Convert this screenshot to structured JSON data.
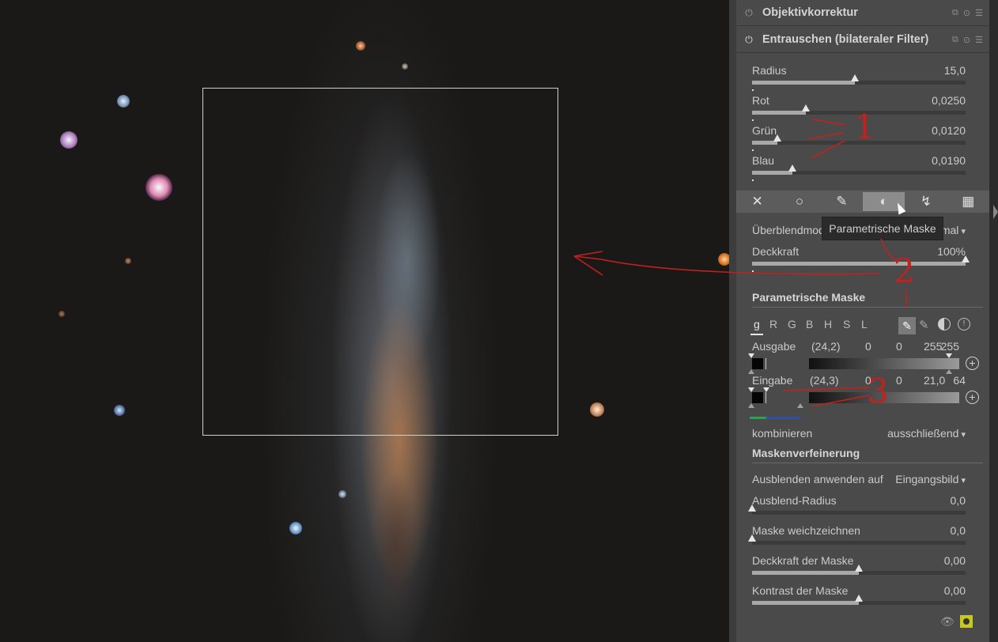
{
  "modules": {
    "lens_correction": {
      "title": "Objektivkorrektur"
    },
    "denoise": {
      "title": "Entrauschen (bilateraler Filter)"
    }
  },
  "denoise_params": [
    {
      "label": "Radius",
      "value": "15,0",
      "level": 0.48
    },
    {
      "label": "Rot",
      "value": "0,0250",
      "level": 0.25
    },
    {
      "label": "Grün",
      "value": "0,0120",
      "level": 0.12
    },
    {
      "label": "Blau",
      "value": "0,0190",
      "level": 0.19
    }
  ],
  "mask_tabs": [
    "off",
    "uniform",
    "drawn",
    "parametric",
    "drawn-and-parametric",
    "raster"
  ],
  "tooltip": "Parametrische Maske",
  "blend": {
    "mode_label": "Überblendmod",
    "mode_value": "mal",
    "opacity_label": "Deckkraft",
    "opacity_value": "100%",
    "opacity_level": 1.0
  },
  "parametric": {
    "title": "Parametrische Maske",
    "channels": [
      "g",
      "R",
      "G",
      "B",
      "H",
      "S",
      "L"
    ],
    "output": {
      "label": "Ausgabe",
      "picked": "(24,2)",
      "v1": "0",
      "v2": "0",
      "v3": "255",
      "v4": "255"
    },
    "input": {
      "label": "Eingabe",
      "picked": "(24,3)",
      "v1": "0",
      "v2": "0",
      "v3": "21,0",
      "v4": "64"
    },
    "combine_label": "kombinieren",
    "combine_value": "ausschließend"
  },
  "refinement": {
    "title": "Maskenverfeinerung",
    "apply_label": "Ausblenden anwenden auf",
    "apply_value": "Eingangsbild",
    "sliders": [
      {
        "label": "Ausblend-Radius",
        "value": "0,0",
        "level": 0.0
      },
      {
        "label": "Maske weichzeichnen",
        "value": "0,0",
        "level": 0.0
      },
      {
        "label": "Deckkraft der Maske",
        "value": "0,00",
        "level": 0.5
      },
      {
        "label": "Kontrast der Maske",
        "value": "0,00",
        "level": 0.5
      }
    ]
  },
  "annotations": {
    "n1": "1",
    "n2": "2",
    "n3": "3"
  },
  "colors": {
    "annotation": "#c0221d",
    "panel": "#4a4a4a",
    "accent": "#e6e6e6"
  }
}
